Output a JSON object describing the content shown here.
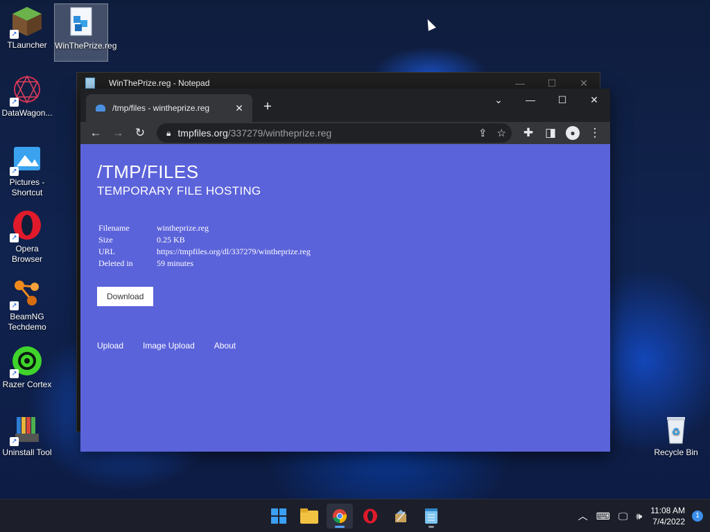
{
  "desktop": {
    "icons": [
      {
        "label": "TLauncher"
      },
      {
        "label": "WinThePrize.reg"
      },
      {
        "label": "DataWagon..."
      },
      {
        "label": "Pictures - Shortcut"
      },
      {
        "label": "Opera Browser"
      },
      {
        "label": "BeamNG Techdemo"
      },
      {
        "label": "Razer Cortex"
      },
      {
        "label": "Uninstall Tool"
      },
      {
        "label": "Recycle Bin"
      }
    ]
  },
  "notepad": {
    "title": "WinThePrize.reg - Notepad"
  },
  "browser": {
    "tab": {
      "title": "/tmp/files - wintheprize.reg"
    },
    "url": {
      "host": "tmpfiles.org",
      "path": "/337279/wintheprize.reg"
    }
  },
  "page": {
    "title": "/TMP/FILES",
    "subtitle": "TEMPORARY FILE HOSTING",
    "info": [
      {
        "key": "Filename",
        "value": "wintheprize.reg"
      },
      {
        "key": "Size",
        "value": "0.25 KB"
      },
      {
        "key": "URL",
        "value": "https://tmpfiles.org/dl/337279/wintheprize.reg"
      },
      {
        "key": "Deleted in",
        "value": "59 minutes"
      }
    ],
    "download_label": "Download",
    "footer_links": [
      "Upload",
      "Image Upload",
      "About"
    ]
  },
  "taskbar": {
    "clock": {
      "time": "11:08 AM",
      "date": "7/4/2022"
    },
    "notification_count": "1"
  },
  "colors": {
    "page_bg": "#5b63da",
    "chrome_dark": "#202124",
    "chrome_tab": "#35363a"
  }
}
